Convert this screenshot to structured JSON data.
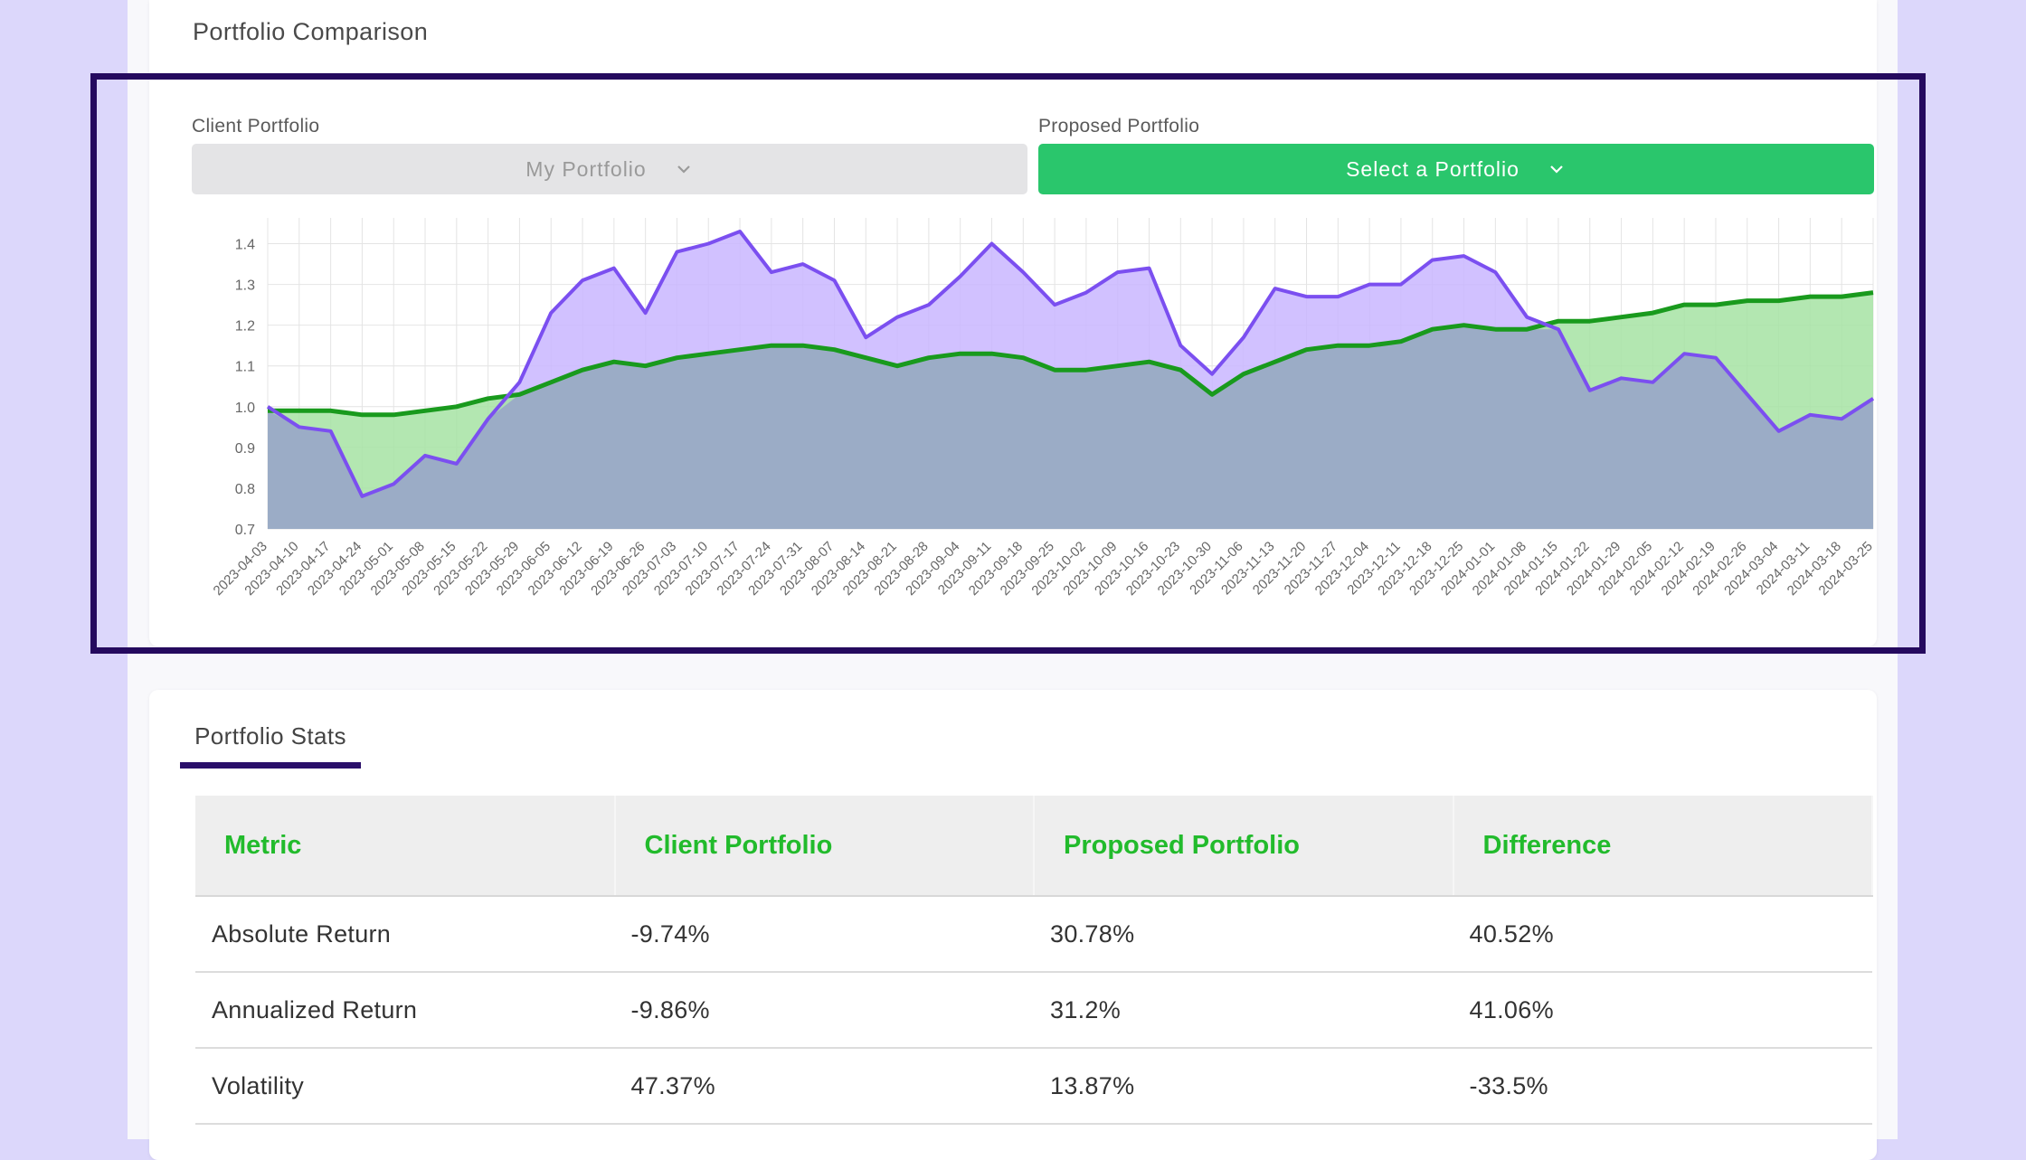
{
  "header": {
    "title": "Portfolio Comparison"
  },
  "selectors": {
    "client_label": "Client Portfolio",
    "client_value": "My Portfolio",
    "proposed_label": "Proposed Portfolio",
    "proposed_value": "Select a Portfolio"
  },
  "colors": {
    "client_line": "#7b4ff0",
    "client_fill": "#c9b6ff",
    "proposed_line": "#199a1d",
    "proposed_fill": "#a6e3a3",
    "overlap_fill": "#9bacc6",
    "highlight_border": "#250a5e",
    "accent_green": "#2ac66c"
  },
  "chart_data": {
    "type": "area",
    "title": "",
    "xlabel": "",
    "ylabel": "",
    "ylim": [
      0.7,
      1.45
    ],
    "yticks": [
      0.7,
      0.8,
      0.9,
      1.0,
      1.1,
      1.2,
      1.3,
      1.4
    ],
    "x_tick_labels": [
      "2023-04-03",
      "2023-04-10",
      "2023-04-17",
      "2023-04-24",
      "2023-05-01",
      "2023-05-08",
      "2023-05-15",
      "2023-05-22",
      "2023-05-29",
      "2023-06-05",
      "2023-06-12",
      "2023-06-19",
      "2023-06-26",
      "2023-07-03",
      "2023-07-10",
      "2023-07-17",
      "2023-07-24",
      "2023-07-31",
      "2023-08-07",
      "2023-08-14",
      "2023-08-21",
      "2023-08-28",
      "2023-09-04",
      "2023-09-11",
      "2023-09-18",
      "2023-09-25",
      "2023-10-02",
      "2023-10-09",
      "2023-10-16",
      "2023-10-23",
      "2023-10-30",
      "2023-11-06",
      "2023-11-13",
      "2023-11-20",
      "2023-11-27",
      "2023-12-04",
      "2023-12-11",
      "2023-12-18",
      "2023-12-25",
      "2024-01-01",
      "2024-01-08",
      "2024-01-15",
      "2024-01-22",
      "2024-01-29",
      "2024-02-05",
      "2024-02-12",
      "2024-02-19",
      "2024-02-26",
      "2024-03-04",
      "2024-03-11",
      "2024-03-18",
      "2024-03-25"
    ],
    "grid": true,
    "legend": "none",
    "series": [
      {
        "values": [
          1.0,
          0.95,
          0.94,
          0.78,
          0.81,
          0.88,
          0.86,
          0.97,
          1.06,
          1.23,
          1.31,
          1.34,
          1.23,
          1.38,
          1.4,
          1.43,
          1.33,
          1.35,
          1.31,
          1.17,
          1.22,
          1.25,
          1.32,
          1.4,
          1.33,
          1.25,
          1.28,
          1.33,
          1.34,
          1.15,
          1.08,
          1.17,
          1.29,
          1.27,
          1.27,
          1.3,
          1.3,
          1.36,
          1.37,
          1.33,
          1.22,
          1.19,
          1.04,
          1.07,
          1.06,
          1.13,
          1.12,
          1.03,
          0.94,
          0.98,
          0.97,
          1.02
        ]
      },
      {
        "values": [
          0.99,
          0.99,
          0.99,
          0.98,
          0.98,
          0.99,
          1.0,
          1.02,
          1.03,
          1.06,
          1.09,
          1.11,
          1.1,
          1.12,
          1.13,
          1.14,
          1.15,
          1.15,
          1.14,
          1.12,
          1.1,
          1.12,
          1.13,
          1.13,
          1.12,
          1.09,
          1.09,
          1.1,
          1.11,
          1.09,
          1.03,
          1.08,
          1.11,
          1.14,
          1.15,
          1.15,
          1.16,
          1.19,
          1.2,
          1.19,
          1.19,
          1.21,
          1.21,
          1.22,
          1.23,
          1.25,
          1.25,
          1.26,
          1.26,
          1.27,
          1.27,
          1.28
        ]
      }
    ]
  },
  "stats": {
    "tab_label": "Portfolio Stats",
    "headers": [
      "Metric",
      "Client Portfolio",
      "Proposed Portfolio",
      "Difference"
    ],
    "rows": [
      [
        "Absolute Return",
        "-9.74%",
        "30.78%",
        "40.52%"
      ],
      [
        "Annualized Return",
        "-9.86%",
        "31.2%",
        "41.06%"
      ],
      [
        "Volatility",
        "47.37%",
        "13.87%",
        "-33.5%"
      ]
    ]
  }
}
